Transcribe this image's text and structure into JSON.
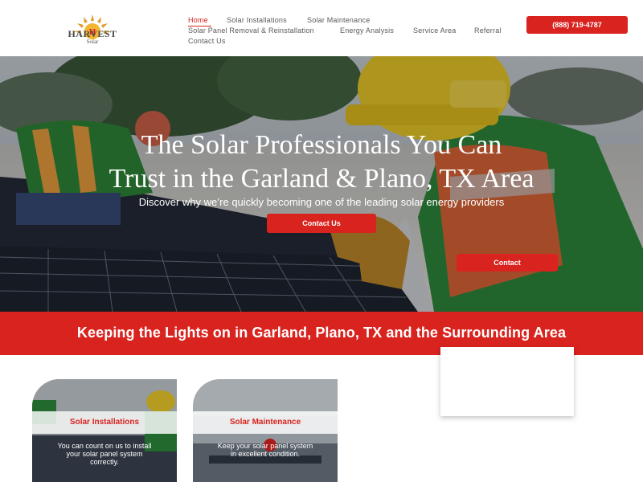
{
  "brand": {
    "name": "HARVEST",
    "sub": "Solar",
    "logo_icon": "sun-icon",
    "accent": "#d9231f"
  },
  "nav": {
    "items": [
      {
        "label": "Home",
        "active": true
      },
      {
        "label": "Solar Installations"
      },
      {
        "label": "Solar Maintenance"
      },
      {
        "label": "Solar Panel Removal & Reinstallation"
      },
      {
        "label": "Energy Analysis"
      },
      {
        "label": "Service Area"
      },
      {
        "label": "Referral"
      },
      {
        "label": "Contact Us"
      }
    ]
  },
  "header": {
    "phone": "(888) 719-4787"
  },
  "hero": {
    "title_line1": "The Solar Professionals You Can",
    "title_line2": "Trust in the Garland & Plano, TX Area",
    "subtitle": "Discover why we’re quickly becoming one of the leading solar energy providers",
    "cta": "Contact Us",
    "cta2": "Contact"
  },
  "band": {
    "text": "Keeping the Lights on in Garland, Plano, TX and the Surrounding Area"
  },
  "cards": [
    {
      "title": "Solar Installations",
      "desc": "You can count on us to install your solar panel system correctly."
    },
    {
      "title": "Solar Maintenance",
      "desc": "Keep your solar panel system in excellent condition."
    }
  ]
}
